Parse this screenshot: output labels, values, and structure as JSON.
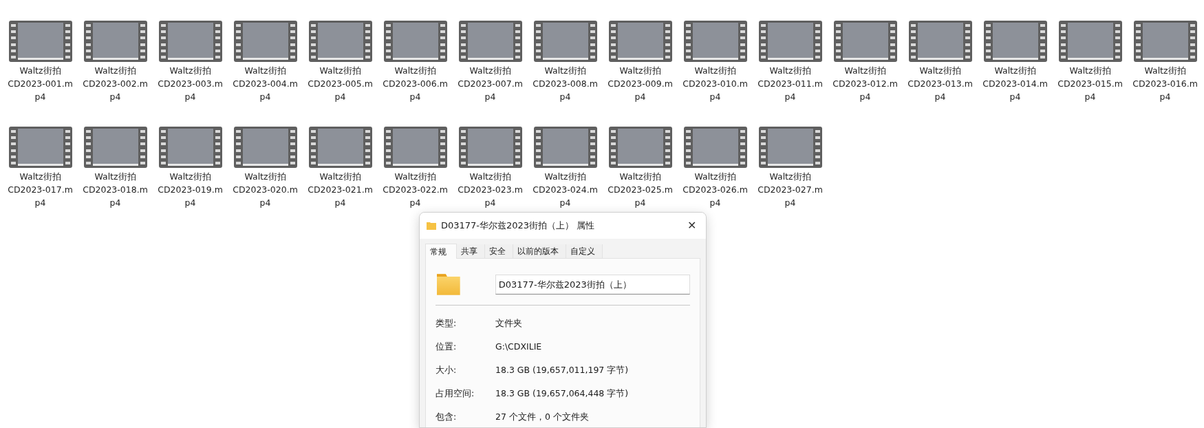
{
  "files": [
    {
      "label_lines": [
        "Waltz街拍",
        "CD2023-001.m",
        "p4"
      ]
    },
    {
      "label_lines": [
        "Waltz街拍",
        "CD2023-002.m",
        "p4"
      ]
    },
    {
      "label_lines": [
        "Waltz街拍",
        "CD2023-003.m",
        "p4"
      ]
    },
    {
      "label_lines": [
        "Waltz街拍",
        "CD2023-004.m",
        "p4"
      ]
    },
    {
      "label_lines": [
        "Waltz街拍",
        "CD2023-005.m",
        "p4"
      ]
    },
    {
      "label_lines": [
        "Waltz街拍",
        "CD2023-006.m",
        "p4"
      ]
    },
    {
      "label_lines": [
        "Waltz街拍",
        "CD2023-007.m",
        "p4"
      ]
    },
    {
      "label_lines": [
        "Waltz街拍",
        "CD2023-008.m",
        "p4"
      ]
    },
    {
      "label_lines": [
        "Waltz街拍",
        "CD2023-009.m",
        "p4"
      ]
    },
    {
      "label_lines": [
        "Waltz街拍",
        "CD2023-010.m",
        "p4"
      ]
    },
    {
      "label_lines": [
        "Waltz街拍",
        "CD2023-011.m",
        "p4"
      ]
    },
    {
      "label_lines": [
        "Waltz街拍",
        "CD2023-012.m",
        "p4"
      ]
    },
    {
      "label_lines": [
        "Waltz街拍",
        "CD2023-013.m",
        "p4"
      ]
    },
    {
      "label_lines": [
        "Waltz街拍",
        "CD2023-014.m",
        "p4"
      ]
    },
    {
      "label_lines": [
        "Waltz街拍",
        "CD2023-015.m",
        "p4"
      ]
    },
    {
      "label_lines": [
        "Waltz街拍",
        "CD2023-016.m",
        "p4"
      ]
    },
    {
      "label_lines": [
        "Waltz街拍",
        "CD2023-017.m",
        "p4"
      ]
    },
    {
      "label_lines": [
        "Waltz街拍",
        "CD2023-018.m",
        "p4"
      ]
    },
    {
      "label_lines": [
        "Waltz街拍",
        "CD2023-019.m",
        "p4"
      ]
    },
    {
      "label_lines": [
        "Waltz街拍",
        "CD2023-020.m",
        "p4"
      ]
    },
    {
      "label_lines": [
        "Waltz街拍",
        "CD2023-021.m",
        "p4"
      ]
    },
    {
      "label_lines": [
        "Waltz街拍",
        "CD2023-022.m",
        "p4"
      ]
    },
    {
      "label_lines": [
        "Waltz街拍",
        "CD2023-023.m",
        "p4"
      ]
    },
    {
      "label_lines": [
        "Waltz街拍",
        "CD2023-024.m",
        "p4"
      ]
    },
    {
      "label_lines": [
        "Waltz街拍",
        "CD2023-025.m",
        "p4"
      ]
    },
    {
      "label_lines": [
        "Waltz街拍",
        "CD2023-026.m",
        "p4"
      ]
    },
    {
      "label_lines": [
        "Waltz街拍",
        "CD2023-027.m",
        "p4"
      ]
    }
  ],
  "dialog": {
    "title": "D03177-华尔兹2023街拍（上） 属性",
    "close": "✕",
    "tabs": [
      {
        "label": "常规",
        "selected": true
      },
      {
        "label": "共享",
        "selected": false
      },
      {
        "label": "安全",
        "selected": false
      },
      {
        "label": "以前的版本",
        "selected": false
      },
      {
        "label": "自定义",
        "selected": false
      }
    ],
    "name_value": "D03177-华尔兹2023街拍（上）",
    "properties": [
      {
        "label": "类型:",
        "value": "文件夹"
      },
      {
        "label": "位置:",
        "value": "G:\\CDXILIE"
      },
      {
        "label": "大小:",
        "value": "18.3 GB (19,657,011,197 字节)"
      },
      {
        "label": "占用空间:",
        "value": "18.3 GB (19,657,064,448 字节)"
      },
      {
        "label": "包含:",
        "value": "27 个文件，0 个文件夹"
      }
    ]
  }
}
